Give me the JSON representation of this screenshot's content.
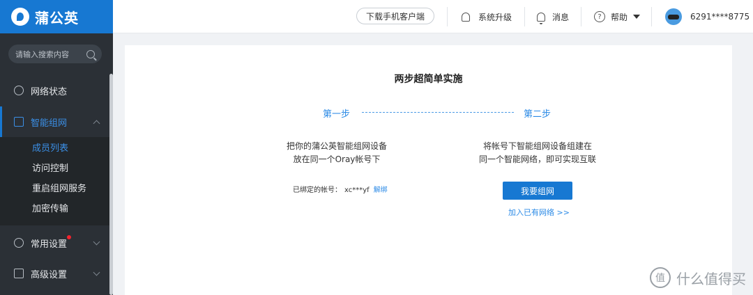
{
  "brand": {
    "name": "蒲公英"
  },
  "search": {
    "placeholder": "请输入搜索内容"
  },
  "sidebar": {
    "items": [
      {
        "label": "网络状态"
      },
      {
        "label": "智能组网"
      },
      {
        "label": "常用设置"
      },
      {
        "label": "高级设置"
      }
    ],
    "subitems": [
      {
        "label": "成员列表"
      },
      {
        "label": "访问控制"
      },
      {
        "label": "重启组网服务"
      },
      {
        "label": "加密传输"
      }
    ]
  },
  "header": {
    "download": "下载手机客户端",
    "upgrade": "系统升级",
    "messages": "消息",
    "help": "帮助",
    "account": "6291****8775"
  },
  "main": {
    "title": "两步超简单实施",
    "step1": "第一步",
    "step2": "第二步",
    "step1_line1": "把你的蒲公英智能组网设备",
    "step1_line2": "放在同一个Oray帐号下",
    "step2_line1": "将帐号下智能组网设备组建在",
    "step2_line2": "同一个智能网络，即可实现互联",
    "bound_label": "已绑定的帐号：",
    "bound_account": "xc***yf",
    "unbind": "解绑",
    "create_btn": "我要组网",
    "join_link": "加入已有网络 >>"
  },
  "watermark": {
    "badge": "值",
    "text": "什么值得买"
  },
  "colors": {
    "brand": "#1778d2",
    "sidebar": "#2b3036",
    "link": "#2b8ae6",
    "badge": "#f5222d"
  }
}
